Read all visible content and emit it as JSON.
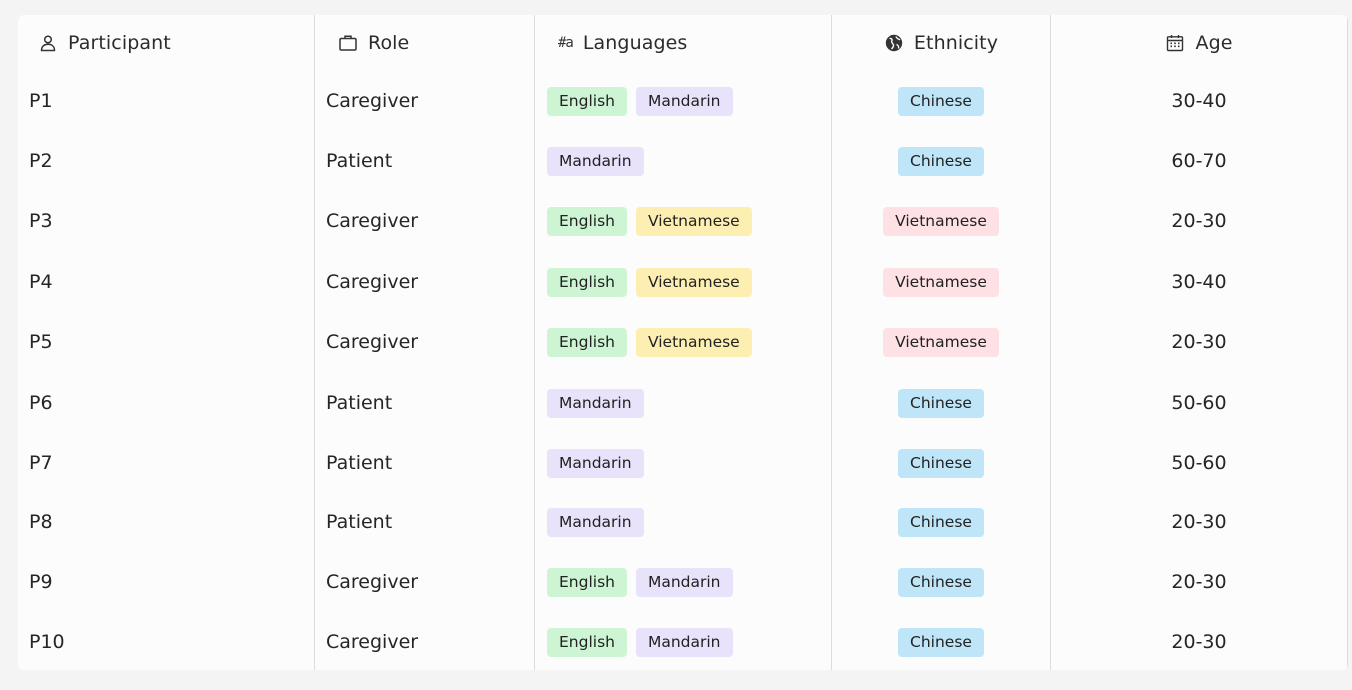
{
  "columns": [
    {
      "label": "Participant",
      "icon": "person-icon"
    },
    {
      "label": "Role",
      "icon": "briefcase-icon"
    },
    {
      "label": "Languages",
      "icon": "language-icon",
      "icon_text": "#a"
    },
    {
      "label": "Ethnicity",
      "icon": "globe-icon"
    },
    {
      "label": "Age",
      "icon": "calendar-icon"
    }
  ],
  "tag_colors": {
    "English": "#cdf5d3",
    "Mandarin": "#e8e2fb",
    "Vietnamese": "#fdefb2",
    "Chinese": "#bfe6f8",
    "Vietnamese_ethnicity": "#fde1e4"
  },
  "rows": [
    {
      "participant": "P1",
      "role": "Caregiver",
      "languages": [
        "English",
        "Mandarin"
      ],
      "ethnicity": "Chinese",
      "age": "30-40"
    },
    {
      "participant": "P2",
      "role": "Patient",
      "languages": [
        "Mandarin"
      ],
      "ethnicity": "Chinese",
      "age": "60-70"
    },
    {
      "participant": "P3",
      "role": "Caregiver",
      "languages": [
        "English",
        "Vietnamese"
      ],
      "ethnicity": "Vietnamese",
      "age": "20-30"
    },
    {
      "participant": "P4",
      "role": "Caregiver",
      "languages": [
        "English",
        "Vietnamese"
      ],
      "ethnicity": "Vietnamese",
      "age": "30-40"
    },
    {
      "participant": "P5",
      "role": "Caregiver",
      "languages": [
        "English",
        "Vietnamese"
      ],
      "ethnicity": "Vietnamese",
      "age": "20-30"
    },
    {
      "participant": "P6",
      "role": "Patient",
      "languages": [
        "Mandarin"
      ],
      "ethnicity": "Chinese",
      "age": "50-60"
    },
    {
      "participant": "P7",
      "role": "Patient",
      "languages": [
        "Mandarin"
      ],
      "ethnicity": "Chinese",
      "age": "50-60"
    },
    {
      "participant": "P8",
      "role": "Patient",
      "languages": [
        "Mandarin"
      ],
      "ethnicity": "Chinese",
      "age": "20-30"
    },
    {
      "participant": "P9",
      "role": "Caregiver",
      "languages": [
        "English",
        "Mandarin"
      ],
      "ethnicity": "Chinese",
      "age": "20-30"
    },
    {
      "participant": "P10",
      "role": "Caregiver",
      "languages": [
        "English",
        "Mandarin"
      ],
      "ethnicity": "Chinese",
      "age": "20-30"
    }
  ]
}
